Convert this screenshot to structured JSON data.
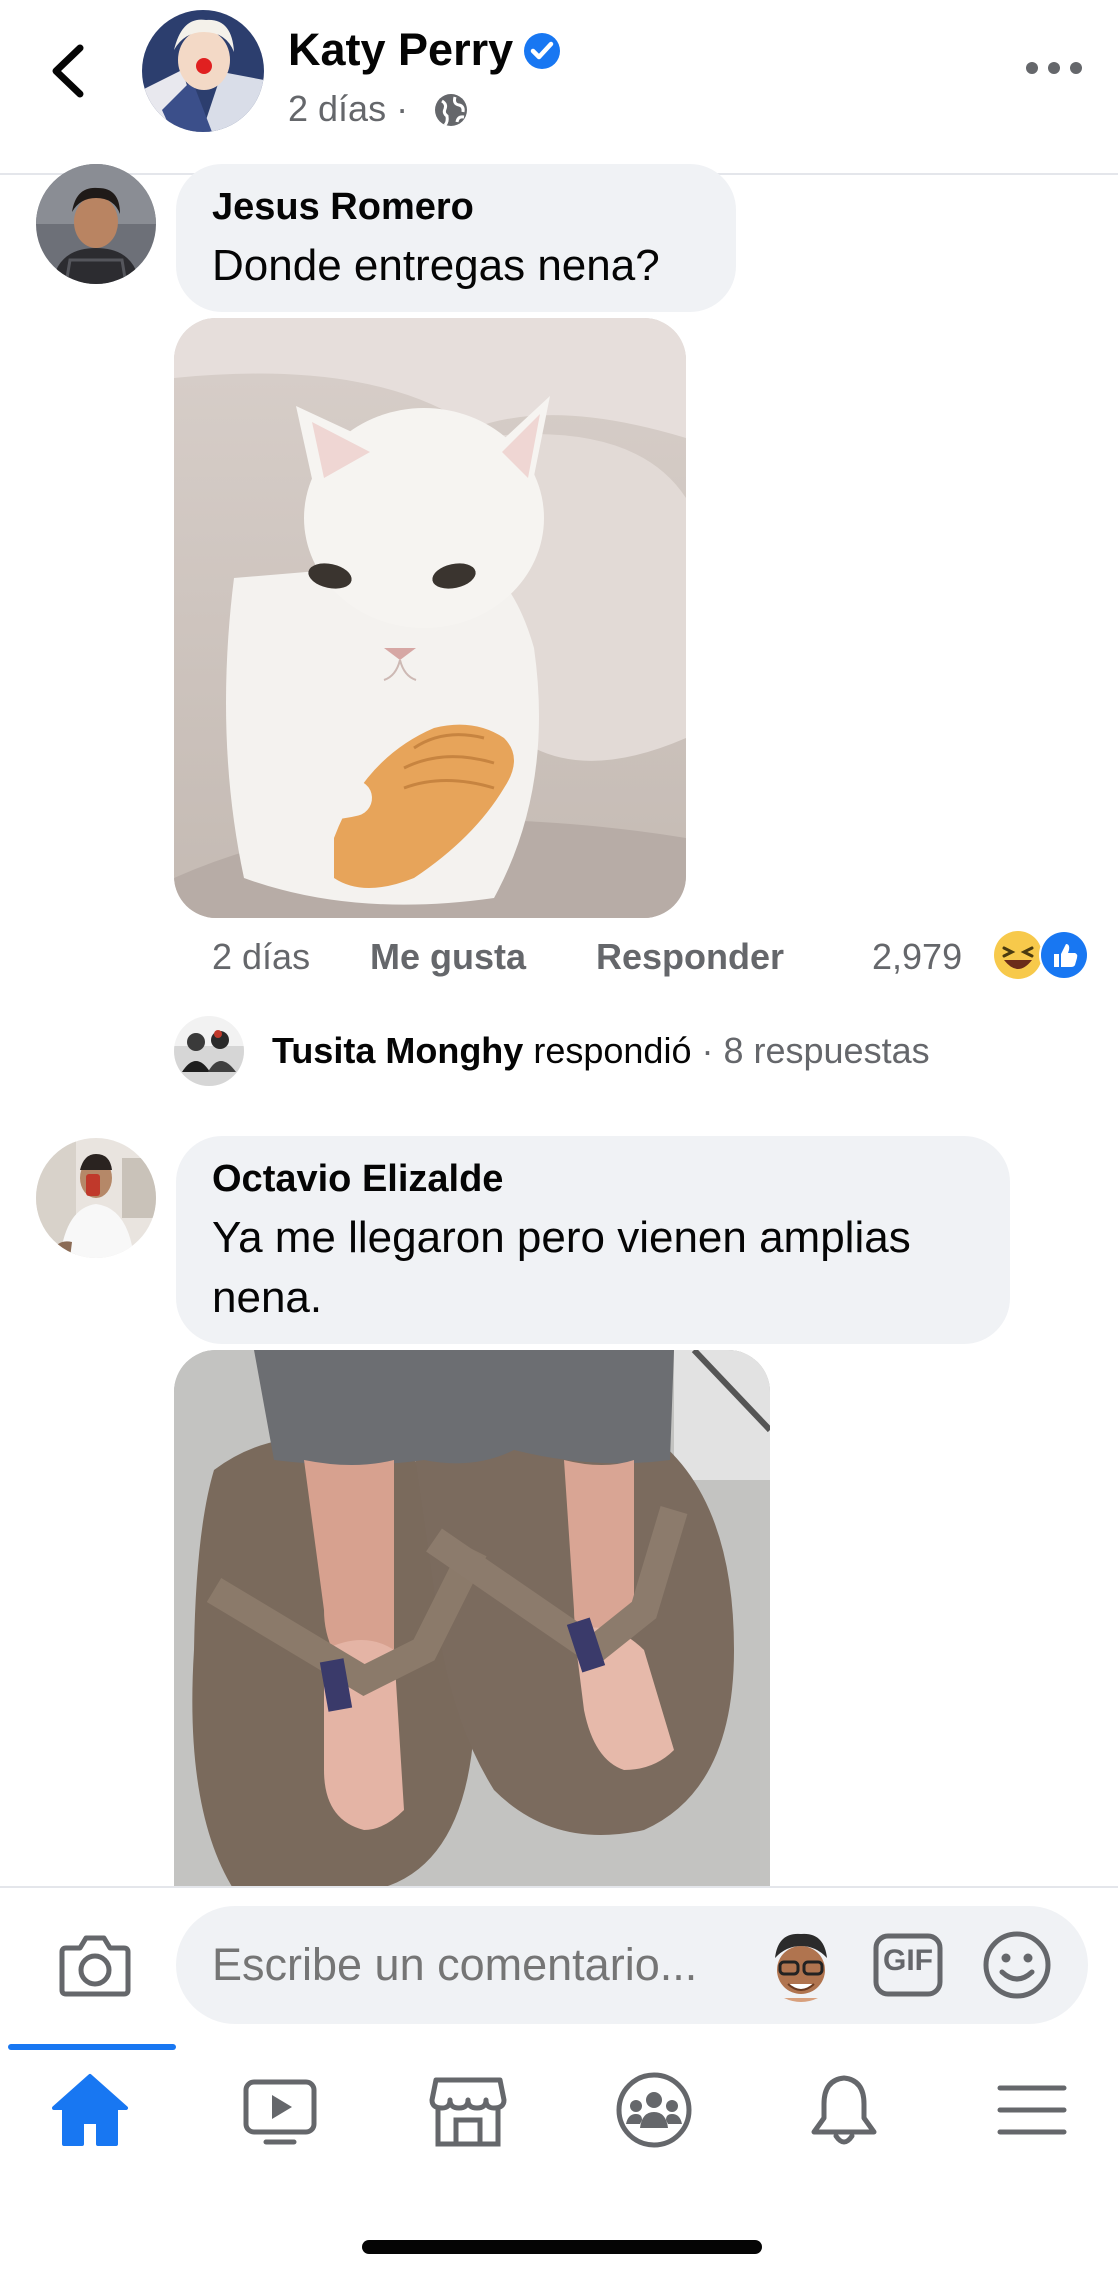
{
  "header": {
    "name": "Katy Perry",
    "time": "2 días",
    "separator": "·",
    "accent": "#1877f2"
  },
  "comments": [
    {
      "author": "Jesus Romero",
      "text": "Donde entregas nena?",
      "photo": "white-cat-holding-hand",
      "time": "2 días",
      "like_label": "Me gusta",
      "reply_label": "Responder",
      "reactions_count": "2,979",
      "reactions": [
        "haha-icon",
        "like-icon"
      ],
      "replies": {
        "name": "Tusita Monghy",
        "action": "respondió",
        "count": "· 8 respuestas"
      }
    },
    {
      "author": "Octavio Elizalde",
      "text_line1": "Ya me llegaron pero vienen amplias",
      "text_line2": "nena.",
      "photo": "feet-on-giant-sandals"
    }
  ],
  "composer": {
    "placeholder": "Escribe un comentario...",
    "gif_label": "GIF"
  },
  "nav": {
    "items": [
      "home-icon",
      "video-icon",
      "marketplace-icon",
      "groups-icon",
      "notifications-icon",
      "menu-icon"
    ],
    "active": "home-icon"
  },
  "colors": {
    "bubble": "#f0f2f5",
    "muted": "#65676b",
    "blue": "#1877f2"
  }
}
